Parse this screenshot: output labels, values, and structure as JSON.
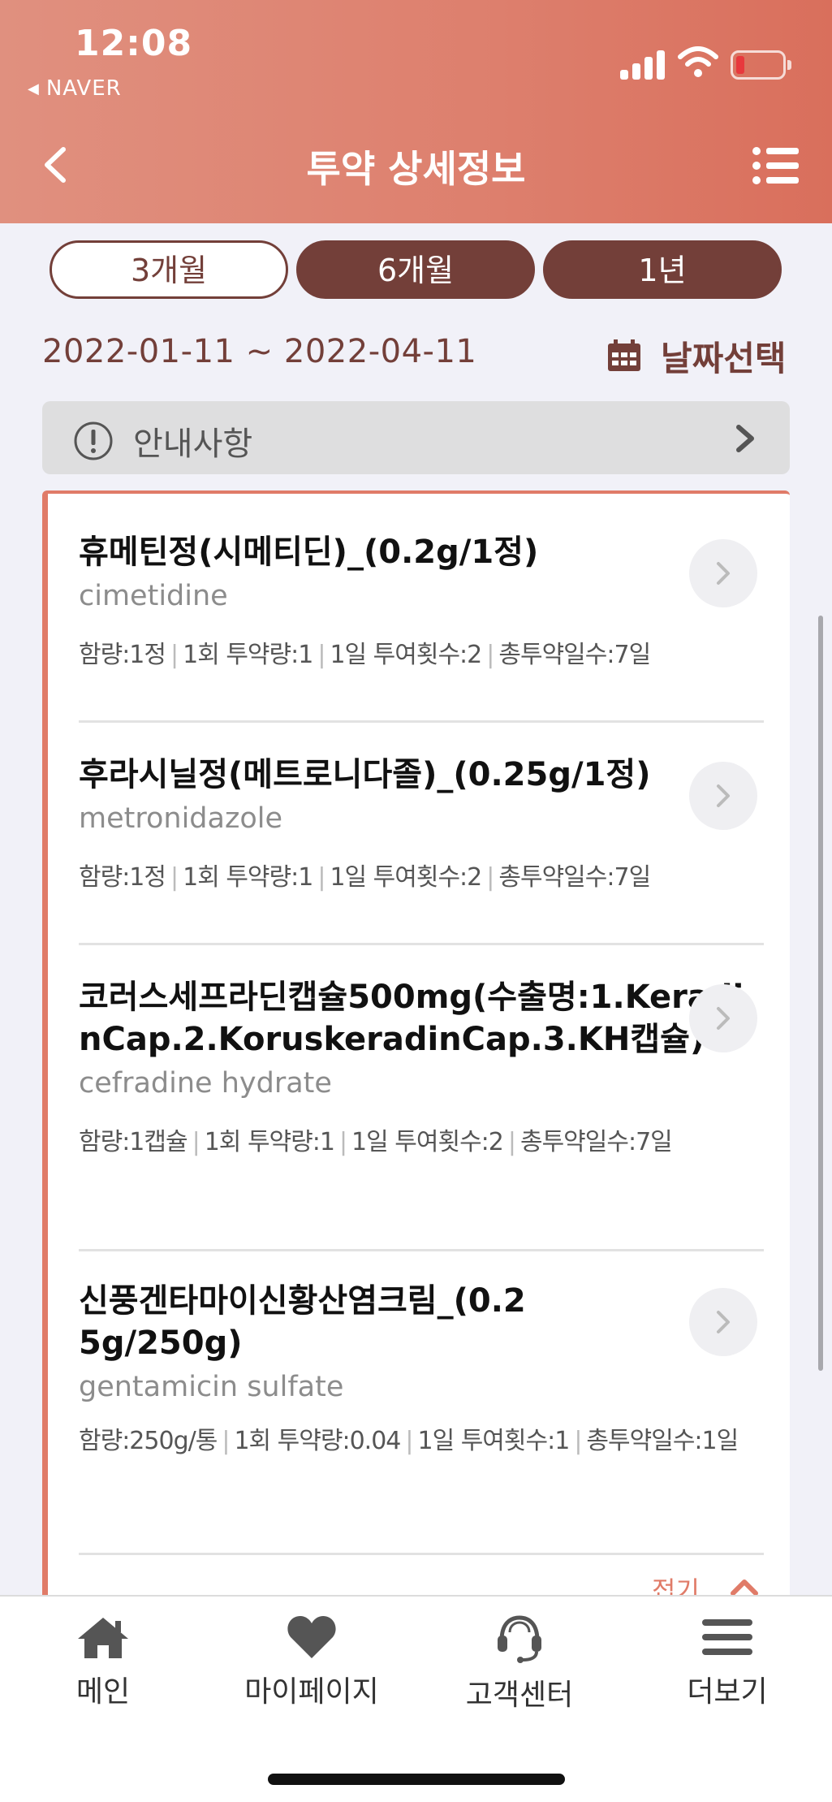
{
  "status_bar": {
    "time": "12:08",
    "back_app": "NAVER"
  },
  "header": {
    "title": "투약 상세정보"
  },
  "period_tabs": [
    {
      "label": "3개월",
      "selected": true
    },
    {
      "label": "6개월",
      "selected": false
    },
    {
      "label": "1년",
      "selected": false
    }
  ],
  "date_range": "2022-01-11 ~ 2022-04-11",
  "date_select_label": "날짜선택",
  "notice": {
    "label": "안내사항"
  },
  "drugs": [
    {
      "name": "휴메틴정(시메티딘)_(0.2g/1정)",
      "generic": "cimetidine",
      "details": [
        "함량:1정",
        "1회 투약량:1",
        "1일 투여횟수:2",
        "총투약일수:7일"
      ]
    },
    {
      "name": "후라시닐정(메트로니다졸)_(0.25g/1정)",
      "generic": "metronidazole",
      "details": [
        "함량:1정",
        "1회 투약량:1",
        "1일 투여횟수:2",
        "총투약일수:7일"
      ]
    },
    {
      "name": "코러스세프라딘캡슐500mg(수출명:1.KeradinCap.2.KoruskeradinCap.3.KH캡슐)",
      "generic": "cefradine hydrate",
      "details": [
        "함량:1캡슐",
        "1회 투약량:1",
        "1일 투여횟수:2",
        "총투약일수:7일"
      ]
    },
    {
      "name": "신풍겐타마이신황산염크림_(0.25g/250g)",
      "generic": "gentamicin sulfate",
      "details": [
        "함량:250g/통",
        "1회 투약량:0.04",
        "1일 투여횟수:1",
        "총투약일수:1일"
      ]
    }
  ],
  "fold_label": "접기",
  "bottom_nav": [
    {
      "label": "메인",
      "icon": "home-icon"
    },
    {
      "label": "마이페이지",
      "icon": "heart-icon"
    },
    {
      "label": "고객센터",
      "icon": "headset-icon"
    },
    {
      "label": "더보기",
      "icon": "hamburger-icon"
    }
  ],
  "colors": {
    "header": "#dd7f6d",
    "primary_brown": "#733f39",
    "accent": "#e07b68"
  }
}
